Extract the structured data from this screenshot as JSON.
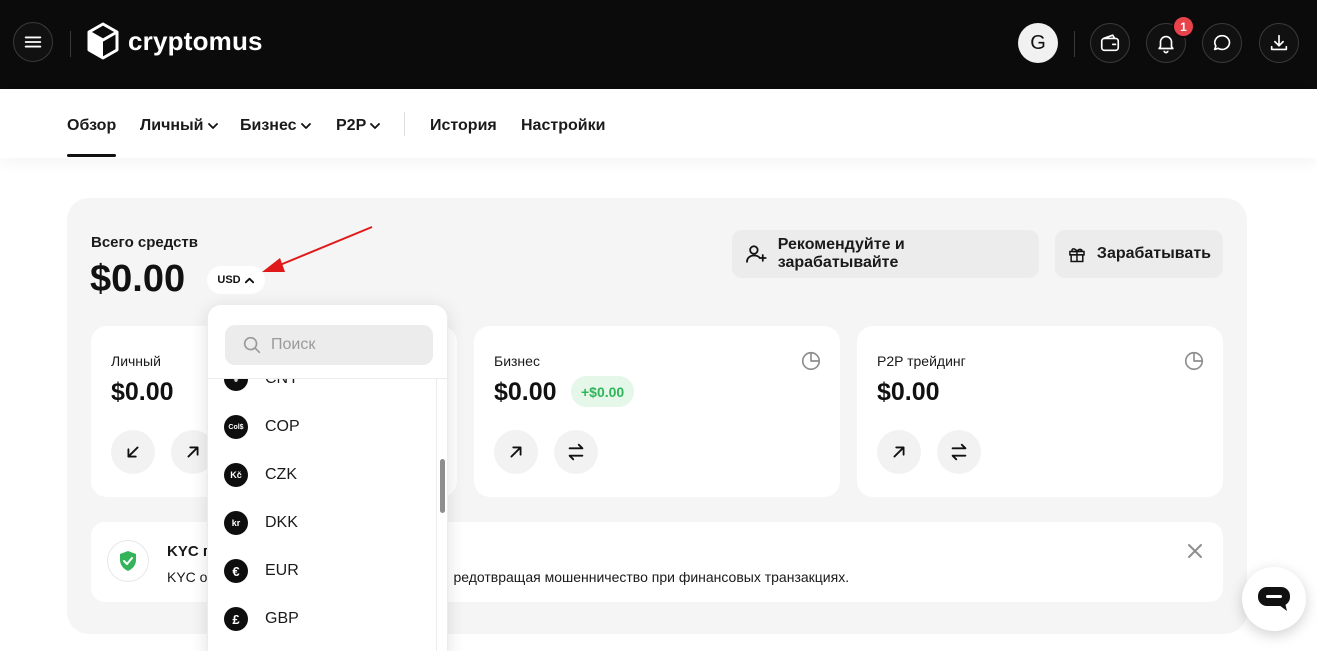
{
  "brand": {
    "name": "cryptomus"
  },
  "header": {
    "avatar_letter": "G",
    "notification_count": "1",
    "icons": [
      "menu-icon",
      "wallet-icon",
      "bell-icon",
      "chat-icon",
      "download-icon"
    ]
  },
  "nav": {
    "items": [
      {
        "label": "Обзор",
        "active": true
      },
      {
        "label": "Личный",
        "dropdown": true
      },
      {
        "label": "Бизнес",
        "dropdown": true
      },
      {
        "label": "P2P",
        "dropdown": true
      },
      {
        "label": "История"
      },
      {
        "label": "Настройки"
      }
    ]
  },
  "overview": {
    "total_label": "Всего средств",
    "total_value": "$0.00",
    "currency": "USD",
    "refer_label": "Рекомендуйте и зарабатывайте",
    "earn_label": "Зарабатывать"
  },
  "cards": [
    {
      "title": "Личный",
      "value": "$0.00"
    },
    {
      "title": "Бизнес",
      "value": "$0.00",
      "badge": "+$0.00"
    },
    {
      "title": "P2P трейдинг",
      "value": "$0.00"
    }
  ],
  "kyc": {
    "title": "KYC п",
    "desc_left": "KYC о",
    "desc_right": "редотвращая мошенничество при финансовых транзакциях."
  },
  "currency_dropdown": {
    "search_placeholder": "Поиск",
    "items": [
      {
        "code": "CNY",
        "symbol": "¥"
      },
      {
        "code": "COP",
        "symbol": "Col$"
      },
      {
        "code": "CZK",
        "symbol": "Kč"
      },
      {
        "code": "DKK",
        "symbol": "kr"
      },
      {
        "code": "EUR",
        "symbol": "€"
      },
      {
        "code": "GBP",
        "symbol": "£"
      }
    ]
  },
  "colors": {
    "topbar": "#0b0b0b",
    "notification": "#e8424b",
    "positive": "#32b45a",
    "annotation_arrow": "#e0191b"
  }
}
